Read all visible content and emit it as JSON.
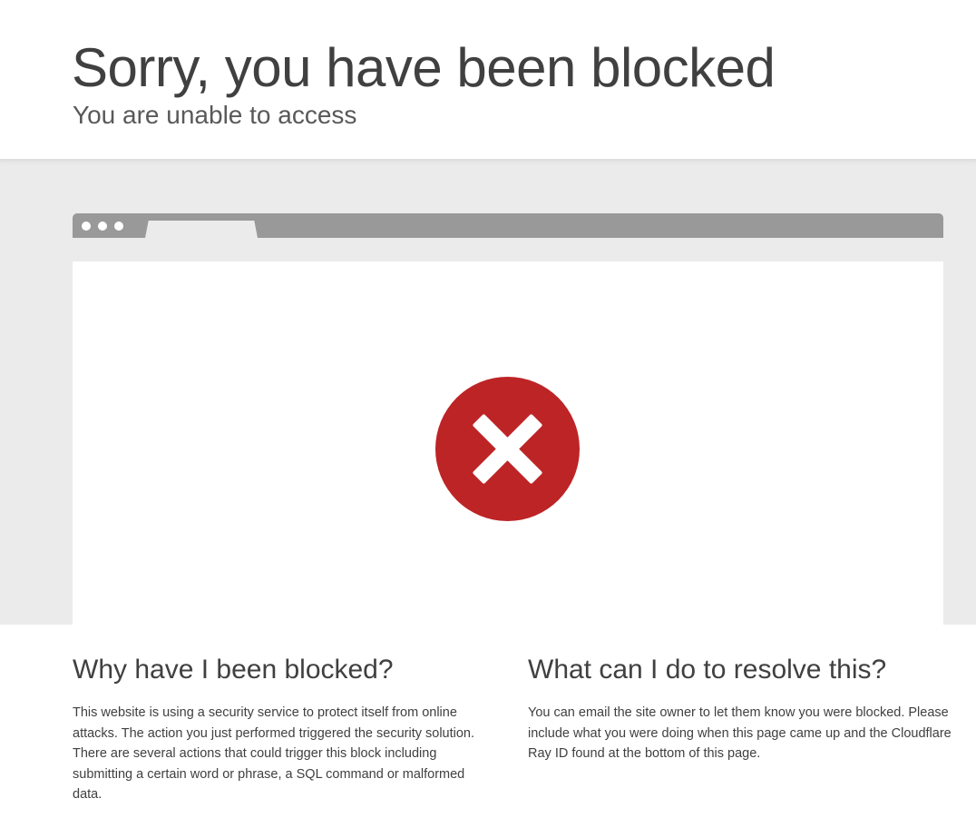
{
  "header": {
    "title": "Sorry, you have been blocked",
    "subtitle": "You are unable to access"
  },
  "icon": {
    "name": "blocked-x-icon",
    "color": "#bd2426"
  },
  "why": {
    "heading": "Why have I been blocked?",
    "body": "This website is using a security service to protect itself from online attacks. The action you just performed triggered the security solution. There are several actions that could trigger this block including submitting a certain word or phrase, a SQL command or malformed data."
  },
  "resolve": {
    "heading": "What can I do to resolve this?",
    "body": "You can email the site owner to let them know you were blocked. Please include what you were doing when this page came up and the Cloudflare Ray ID found at the bottom of this page."
  }
}
